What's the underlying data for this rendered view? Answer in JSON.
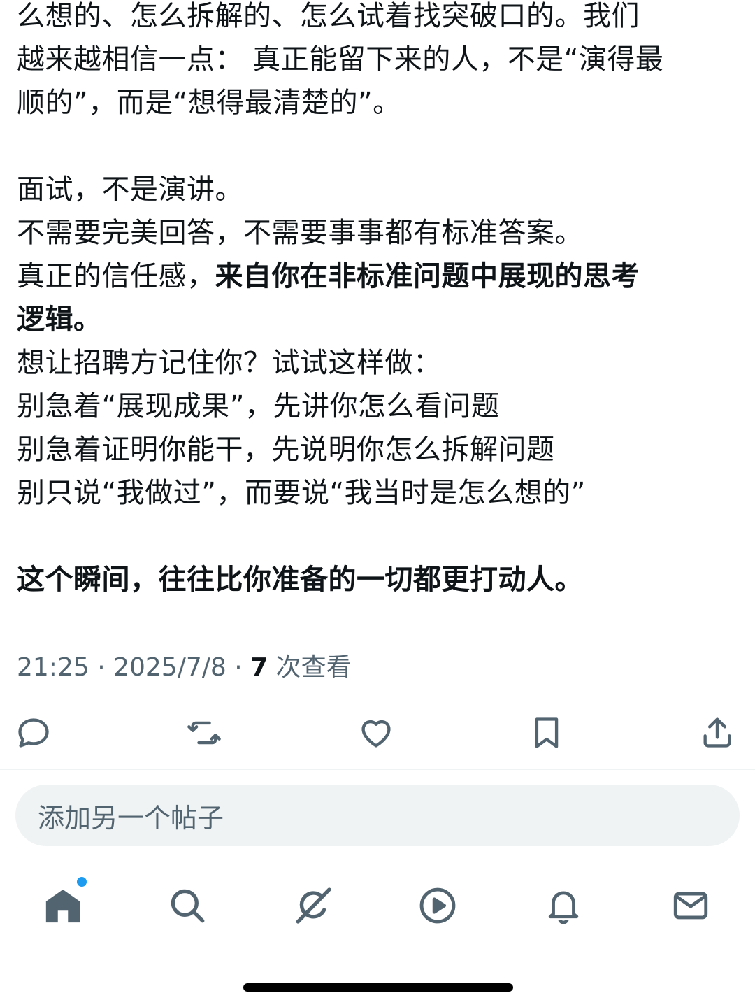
{
  "post": {
    "lines": [
      "么想的、怎么拆解的、怎么试着找突破口的。我们",
      "越来越相信一点： 真正能留下来的人，不是“演得最",
      "顺的”，而是“想得最清楚的”。",
      "面试，不是演讲。",
      "不需要完美回答，不需要事事都有标准答案。",
      "真正的信任感，",
      "来自你在非标准问题中展现的思考",
      "逻辑。",
      "想让招聘方记住你？试试这样做：",
      "别急着“展现成果”，先讲你怎么看问题",
      "别急着证明你能干，先说明你怎么拆解问题",
      "别只说“我做过”，而要说“我当时是怎么想的”",
      "这个瞬间，往往比你准备的一切都更打动人。"
    ]
  },
  "meta": {
    "time": "21:25",
    "separator": " · ",
    "date": "2025/7/8",
    "views_count": "7",
    "views_label": " 次查看"
  },
  "actions": {
    "reply": "reply-icon",
    "repost": "repost-icon",
    "like": "heart-icon",
    "bookmark": "bookmark-icon",
    "share": "share-icon"
  },
  "reply_box": {
    "placeholder": "添加另一个帖子"
  },
  "tab_bar": {
    "items": [
      "home-icon",
      "search-icon",
      "grok-icon",
      "play-icon",
      "bell-icon",
      "mail-icon"
    ],
    "home_has_notification_dot": true
  },
  "colors": {
    "text": "#0f1419",
    "secondary": "#536471",
    "accent": "#1d9bf0",
    "input_bg": "#eff3f4"
  }
}
